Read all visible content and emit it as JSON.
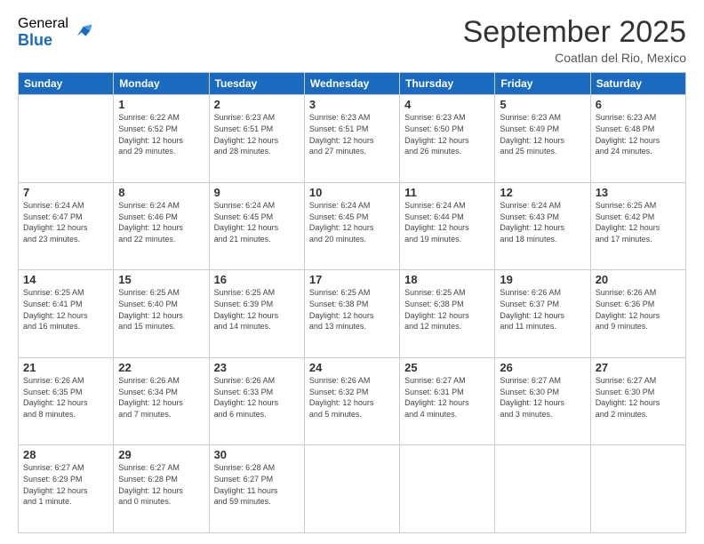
{
  "logo": {
    "general": "General",
    "blue": "Blue"
  },
  "header": {
    "month": "September 2025",
    "location": "Coatlan del Rio, Mexico"
  },
  "weekdays": [
    "Sunday",
    "Monday",
    "Tuesday",
    "Wednesday",
    "Thursday",
    "Friday",
    "Saturday"
  ],
  "weeks": [
    [
      {
        "day": "",
        "info": ""
      },
      {
        "day": "1",
        "info": "Sunrise: 6:22 AM\nSunset: 6:52 PM\nDaylight: 12 hours\nand 29 minutes."
      },
      {
        "day": "2",
        "info": "Sunrise: 6:23 AM\nSunset: 6:51 PM\nDaylight: 12 hours\nand 28 minutes."
      },
      {
        "day": "3",
        "info": "Sunrise: 6:23 AM\nSunset: 6:51 PM\nDaylight: 12 hours\nand 27 minutes."
      },
      {
        "day": "4",
        "info": "Sunrise: 6:23 AM\nSunset: 6:50 PM\nDaylight: 12 hours\nand 26 minutes."
      },
      {
        "day": "5",
        "info": "Sunrise: 6:23 AM\nSunset: 6:49 PM\nDaylight: 12 hours\nand 25 minutes."
      },
      {
        "day": "6",
        "info": "Sunrise: 6:23 AM\nSunset: 6:48 PM\nDaylight: 12 hours\nand 24 minutes."
      }
    ],
    [
      {
        "day": "7",
        "info": "Sunrise: 6:24 AM\nSunset: 6:47 PM\nDaylight: 12 hours\nand 23 minutes."
      },
      {
        "day": "8",
        "info": "Sunrise: 6:24 AM\nSunset: 6:46 PM\nDaylight: 12 hours\nand 22 minutes."
      },
      {
        "day": "9",
        "info": "Sunrise: 6:24 AM\nSunset: 6:45 PM\nDaylight: 12 hours\nand 21 minutes."
      },
      {
        "day": "10",
        "info": "Sunrise: 6:24 AM\nSunset: 6:45 PM\nDaylight: 12 hours\nand 20 minutes."
      },
      {
        "day": "11",
        "info": "Sunrise: 6:24 AM\nSunset: 6:44 PM\nDaylight: 12 hours\nand 19 minutes."
      },
      {
        "day": "12",
        "info": "Sunrise: 6:24 AM\nSunset: 6:43 PM\nDaylight: 12 hours\nand 18 minutes."
      },
      {
        "day": "13",
        "info": "Sunrise: 6:25 AM\nSunset: 6:42 PM\nDaylight: 12 hours\nand 17 minutes."
      }
    ],
    [
      {
        "day": "14",
        "info": "Sunrise: 6:25 AM\nSunset: 6:41 PM\nDaylight: 12 hours\nand 16 minutes."
      },
      {
        "day": "15",
        "info": "Sunrise: 6:25 AM\nSunset: 6:40 PM\nDaylight: 12 hours\nand 15 minutes."
      },
      {
        "day": "16",
        "info": "Sunrise: 6:25 AM\nSunset: 6:39 PM\nDaylight: 12 hours\nand 14 minutes."
      },
      {
        "day": "17",
        "info": "Sunrise: 6:25 AM\nSunset: 6:38 PM\nDaylight: 12 hours\nand 13 minutes."
      },
      {
        "day": "18",
        "info": "Sunrise: 6:25 AM\nSunset: 6:38 PM\nDaylight: 12 hours\nand 12 minutes."
      },
      {
        "day": "19",
        "info": "Sunrise: 6:26 AM\nSunset: 6:37 PM\nDaylight: 12 hours\nand 11 minutes."
      },
      {
        "day": "20",
        "info": "Sunrise: 6:26 AM\nSunset: 6:36 PM\nDaylight: 12 hours\nand 9 minutes."
      }
    ],
    [
      {
        "day": "21",
        "info": "Sunrise: 6:26 AM\nSunset: 6:35 PM\nDaylight: 12 hours\nand 8 minutes."
      },
      {
        "day": "22",
        "info": "Sunrise: 6:26 AM\nSunset: 6:34 PM\nDaylight: 12 hours\nand 7 minutes."
      },
      {
        "day": "23",
        "info": "Sunrise: 6:26 AM\nSunset: 6:33 PM\nDaylight: 12 hours\nand 6 minutes."
      },
      {
        "day": "24",
        "info": "Sunrise: 6:26 AM\nSunset: 6:32 PM\nDaylight: 12 hours\nand 5 minutes."
      },
      {
        "day": "25",
        "info": "Sunrise: 6:27 AM\nSunset: 6:31 PM\nDaylight: 12 hours\nand 4 minutes."
      },
      {
        "day": "26",
        "info": "Sunrise: 6:27 AM\nSunset: 6:30 PM\nDaylight: 12 hours\nand 3 minutes."
      },
      {
        "day": "27",
        "info": "Sunrise: 6:27 AM\nSunset: 6:30 PM\nDaylight: 12 hours\nand 2 minutes."
      }
    ],
    [
      {
        "day": "28",
        "info": "Sunrise: 6:27 AM\nSunset: 6:29 PM\nDaylight: 12 hours\nand 1 minute."
      },
      {
        "day": "29",
        "info": "Sunrise: 6:27 AM\nSunset: 6:28 PM\nDaylight: 12 hours\nand 0 minutes."
      },
      {
        "day": "30",
        "info": "Sunrise: 6:28 AM\nSunset: 6:27 PM\nDaylight: 11 hours\nand 59 minutes."
      },
      {
        "day": "",
        "info": ""
      },
      {
        "day": "",
        "info": ""
      },
      {
        "day": "",
        "info": ""
      },
      {
        "day": "",
        "info": ""
      }
    ]
  ]
}
